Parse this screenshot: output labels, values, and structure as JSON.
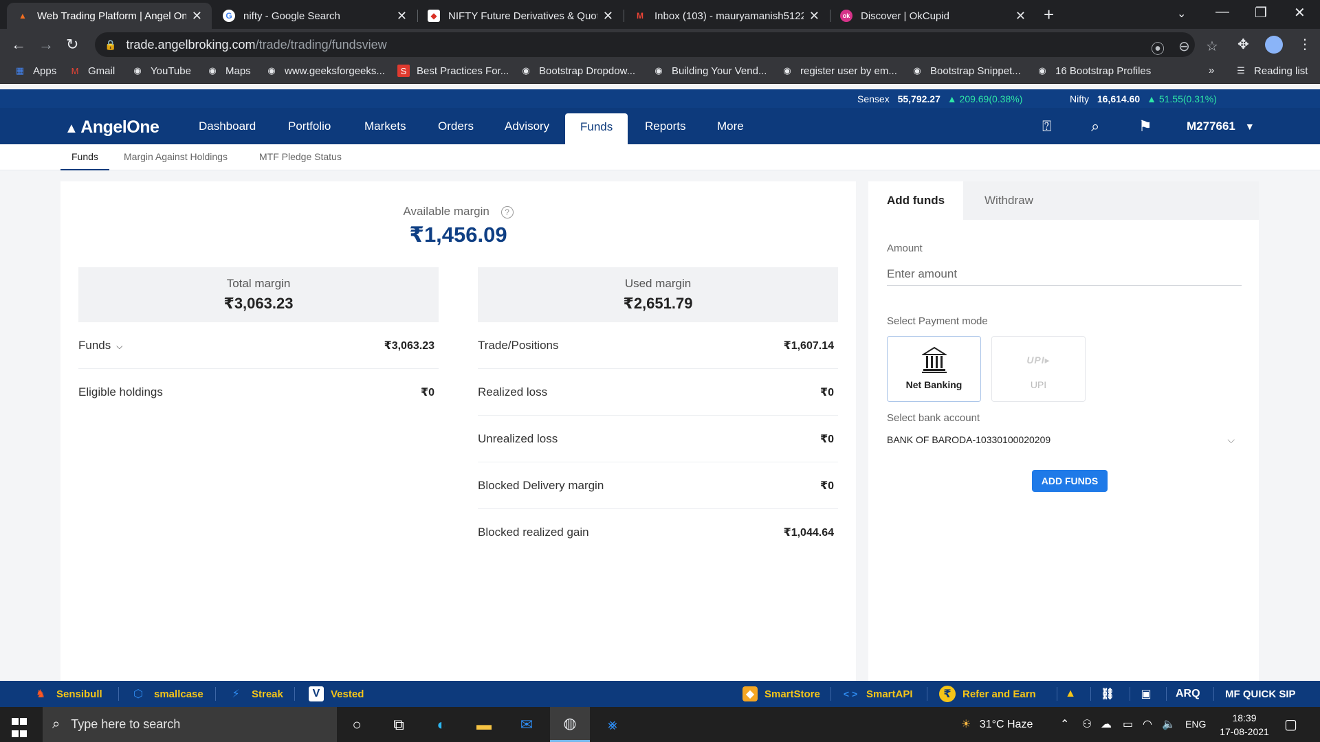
{
  "browser": {
    "tabs": [
      {
        "title": "Web Trading Platform | Angel On",
        "active": true
      },
      {
        "title": "nifty - Google Search",
        "active": false
      },
      {
        "title": "NIFTY Future Derivatives & Quot",
        "active": false
      },
      {
        "title": "Inbox (103) - mauryamanish5122",
        "active": false
      },
      {
        "title": "Discover | OkCupid",
        "active": false
      }
    ],
    "url_domain": "trade.angelbroking.com",
    "url_path": "/trade/trading/fundsview",
    "bookmarks": [
      "Apps",
      "Gmail",
      "YouTube",
      "Maps",
      "www.geeksforgeeks...",
      "Best Practices For...",
      "Bootstrap Dropdow...",
      "Building Your Vend...",
      "register user by em...",
      "Bootstrap Snippet...",
      "16 Bootstrap Profiles"
    ],
    "reading_list": "Reading list",
    "more_bookmarks": "»"
  },
  "ticker": {
    "sensex": {
      "label": "Sensex",
      "value": "55,792.27",
      "change": "▲ 209.69(0.38%)"
    },
    "nifty": {
      "label": "Nifty",
      "value": "16,614.60",
      "change": "▲ 51.55(0.31%)"
    }
  },
  "app": {
    "logo": "AngelOne",
    "menu": [
      "Dashboard",
      "Portfolio",
      "Markets",
      "Orders",
      "Advisory",
      "Funds",
      "Reports",
      "More"
    ],
    "active_menu": "Funds",
    "user_id": "M277661",
    "subtabs": [
      "Funds",
      "Margin Against Holdings",
      "MTF Pledge Status"
    ]
  },
  "funds": {
    "available_label": "Available margin",
    "available_value": "₹1,456.09",
    "total_label": "Total margin",
    "total_value": "₹3,063.23",
    "used_label": "Used margin",
    "used_value": "₹2,651.79",
    "left_rows": [
      {
        "label": "Funds",
        "value": "₹3,063.23"
      },
      {
        "label": "Eligible holdings",
        "value": "₹0"
      }
    ],
    "right_rows": [
      {
        "label": "Trade/Positions",
        "value": "₹1,607.14"
      },
      {
        "label": "Realized loss",
        "value": "₹0"
      },
      {
        "label": "Unrealized loss",
        "value": "₹0"
      },
      {
        "label": "Blocked Delivery margin",
        "value": "₹0"
      },
      {
        "label": "Blocked realized gain",
        "value": "₹1,044.64"
      }
    ]
  },
  "add_funds": {
    "tabs": [
      "Add funds",
      "Withdraw"
    ],
    "amount_label": "Amount",
    "amount_placeholder": "Enter amount",
    "payment_label": "Select Payment mode",
    "payment_modes": [
      "Net Banking",
      "UPI"
    ],
    "bank_label": "Select bank account",
    "bank_value": "BANK OF BARODA-10330100020209",
    "button": "ADD FUNDS"
  },
  "partners": [
    "Sensibull",
    "smallcase",
    "Streak",
    "Vested",
    "SmartStore",
    "SmartAPI",
    "Refer and Earn",
    "MF QUICK SIP"
  ],
  "partner_logo_text": "ARQ",
  "taskbar": {
    "search_placeholder": "Type here to search",
    "weather": "31°C  Haze",
    "language": "ENG",
    "time": "18:39",
    "date": "17-08-2021"
  },
  "colors": {
    "brand_navy": "#0d3a7c",
    "accent_blue": "#1f7ae8",
    "gain_green": "#2ee6a6",
    "partner_yellow": "#f5c518"
  }
}
